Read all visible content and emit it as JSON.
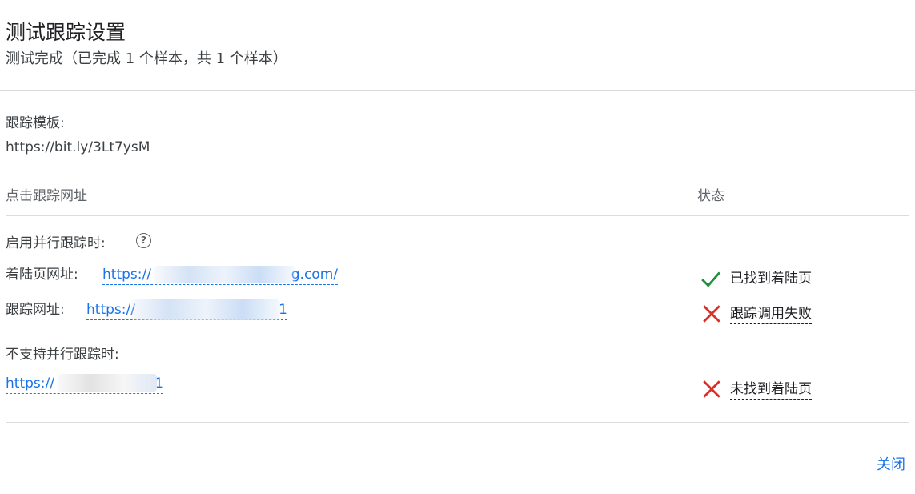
{
  "header": {
    "title": "测试跟踪设置",
    "subtitle": "测试完成（已完成 1 个样本，共 1 个样本）"
  },
  "template": {
    "label": "跟踪模板:",
    "value": "https://bit.ly/3Lt7ysM"
  },
  "columns": {
    "url": "点击跟踪网址",
    "status": "状态"
  },
  "parallel": {
    "heading": "启用并行跟踪时:",
    "help_icon": "help-circle-icon",
    "landing_label": "着陆页网址:",
    "landing_url_start": "https://",
    "landing_url_end": "g.com/",
    "landing_status": "已找到着陆页",
    "tracking_label": "跟踪网址:",
    "tracking_url_start": "https://",
    "tracking_url_end": "1",
    "tracking_status": "跟踪调用失败"
  },
  "non_parallel": {
    "heading": "不支持并行跟踪时:",
    "url_start": "https://",
    "url_end": "1",
    "status": "未找到着陆页"
  },
  "footer": {
    "close_label": "关闭"
  },
  "colors": {
    "success": "#1e8e3e",
    "error": "#d93025",
    "link": "#1a73e8"
  }
}
